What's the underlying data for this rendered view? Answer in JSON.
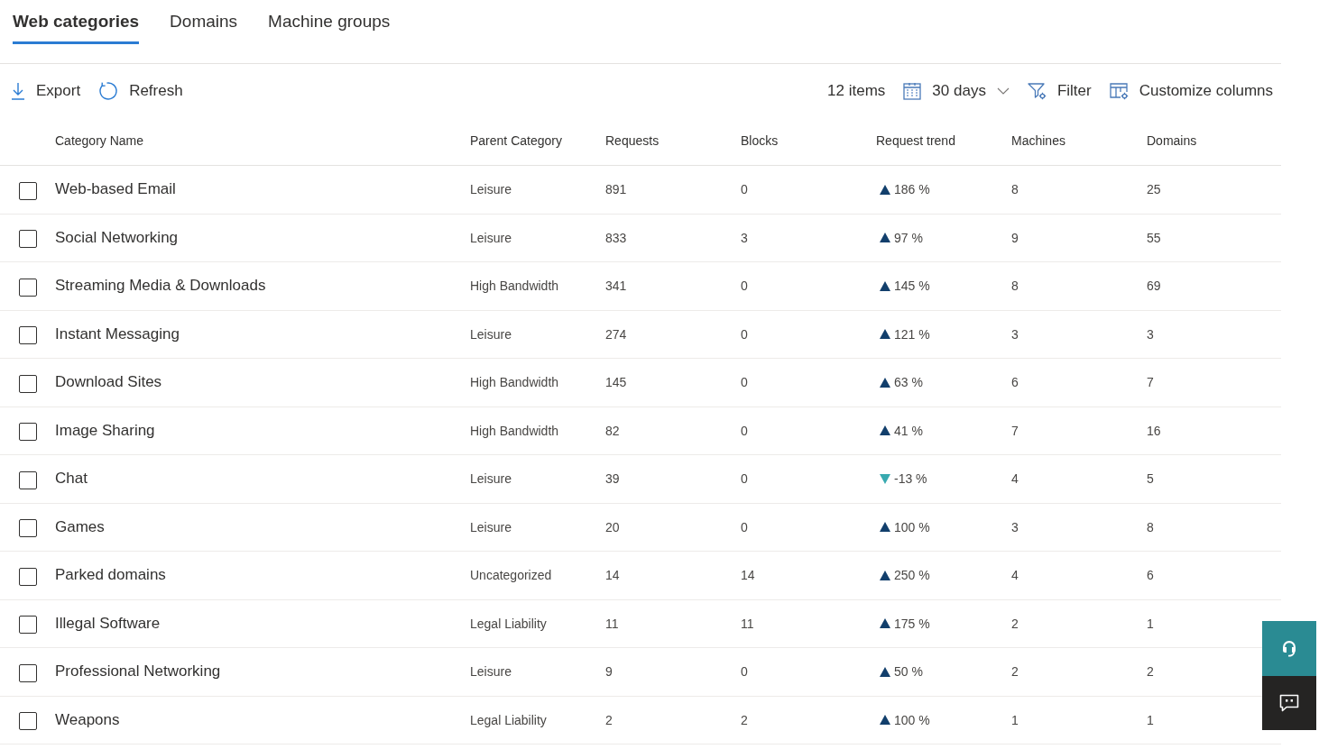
{
  "tabs": [
    {
      "label": "Web categories",
      "selected": true
    },
    {
      "label": "Domains",
      "selected": false
    },
    {
      "label": "Machine groups",
      "selected": false
    }
  ],
  "toolbar": {
    "actions": [
      {
        "kind": "export",
        "label": "Export"
      },
      {
        "kind": "refresh",
        "label": "Refresh"
      }
    ],
    "item_count": "12 items",
    "options": [
      {
        "kind": "date",
        "label": "30 days"
      },
      {
        "kind": "filter",
        "label": "Filter"
      },
      {
        "kind": "columns",
        "label": "Customize columns"
      }
    ]
  },
  "table": {
    "columns": [
      "Category Name",
      "Parent Category",
      "Requests",
      "Blocks",
      "Request trend",
      "Machines",
      "Domains"
    ],
    "rows": [
      {
        "checked": false,
        "name": "Web-based Email",
        "parent": "Leisure",
        "requests": "891",
        "blocks": "0",
        "trend": {
          "kind": "rise",
          "value": "186 %"
        },
        "machines": "8",
        "domains": "25"
      },
      {
        "checked": false,
        "name": "Social Networking",
        "parent": "Leisure",
        "requests": "833",
        "blocks": "3",
        "trend": {
          "kind": "rise",
          "value": "97 %"
        },
        "machines": "9",
        "domains": "55"
      },
      {
        "checked": false,
        "name": "Streaming Media & Downloads",
        "parent": "High Bandwidth",
        "requests": "341",
        "blocks": "0",
        "trend": {
          "kind": "rise",
          "value": "145 %"
        },
        "machines": "8",
        "domains": "69"
      },
      {
        "checked": false,
        "name": "Instant Messaging",
        "parent": "Leisure",
        "requests": "274",
        "blocks": "0",
        "trend": {
          "kind": "rise",
          "value": "121 %"
        },
        "machines": "3",
        "domains": "3"
      },
      {
        "checked": false,
        "name": "Download Sites",
        "parent": "High Bandwidth",
        "requests": "145",
        "blocks": "0",
        "trend": {
          "kind": "rise",
          "value": "63 %"
        },
        "machines": "6",
        "domains": "7"
      },
      {
        "checked": false,
        "name": "Image Sharing",
        "parent": "High Bandwidth",
        "requests": "82",
        "blocks": "0",
        "trend": {
          "kind": "rise",
          "value": "41 %"
        },
        "machines": "7",
        "domains": "16"
      },
      {
        "checked": false,
        "name": "Chat",
        "parent": "Leisure",
        "requests": "39",
        "blocks": "0",
        "trend": {
          "kind": "fall",
          "value": "-13 %"
        },
        "machines": "4",
        "domains": "5"
      },
      {
        "checked": false,
        "name": "Games",
        "parent": "Leisure",
        "requests": "20",
        "blocks": "0",
        "trend": {
          "kind": "rise",
          "value": "100 %"
        },
        "machines": "3",
        "domains": "8"
      },
      {
        "checked": false,
        "name": "Parked domains",
        "parent": "Uncategorized",
        "requests": "14",
        "blocks": "14",
        "trend": {
          "kind": "rise",
          "value": "250 %"
        },
        "machines": "4",
        "domains": "6"
      },
      {
        "checked": false,
        "name": "Illegal Software",
        "parent": "Legal Liability",
        "requests": "11",
        "blocks": "11",
        "trend": {
          "kind": "rise",
          "value": "175 %"
        },
        "machines": "2",
        "domains": "1"
      },
      {
        "checked": false,
        "name": "Professional Networking",
        "parent": "Leisure",
        "requests": "9",
        "blocks": "0",
        "trend": {
          "kind": "rise",
          "value": "50 %"
        },
        "machines": "2",
        "domains": "2"
      },
      {
        "checked": false,
        "name": "Weapons",
        "parent": "Legal Liability",
        "requests": "2",
        "blocks": "2",
        "trend": {
          "kind": "rise",
          "value": "100 %"
        },
        "machines": "1",
        "domains": "1"
      }
    ]
  },
  "side_buttons": [
    {
      "kind": "support"
    },
    {
      "kind": "feedback"
    }
  ]
}
